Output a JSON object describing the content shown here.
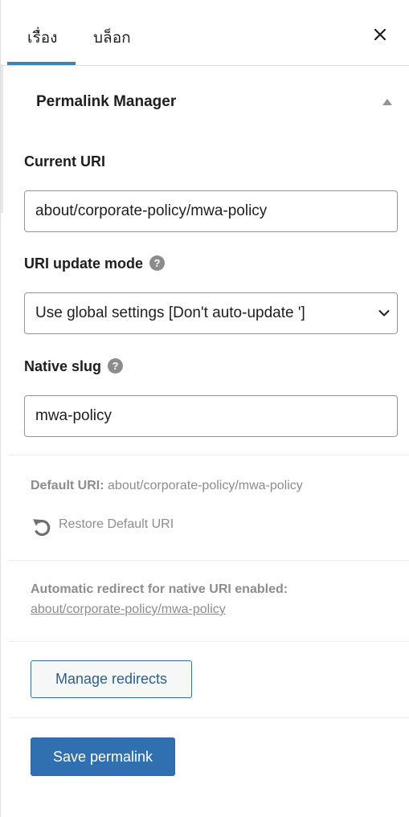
{
  "tabs": {
    "story_label": "เรื่อง",
    "block_label": "บล็อก",
    "close_symbol": "×"
  },
  "section": {
    "title": "Permalink Manager"
  },
  "current_uri": {
    "label": "Current URI",
    "value": "about/corporate-policy/mwa-policy"
  },
  "uri_update_mode": {
    "label": "URI update mode",
    "help_symbol": "?",
    "selected": "Use global settings [Don't auto-update ']"
  },
  "native_slug": {
    "label": "Native slug",
    "help_symbol": "?",
    "value": "mwa-policy"
  },
  "default_uri": {
    "label": "Default URI:",
    "value": "about/corporate-policy/mwa-policy"
  },
  "restore": {
    "label": "Restore Default URI"
  },
  "auto_redirect": {
    "label": "Automatic redirect for native URI enabled:",
    "link": "about/corporate-policy/mwa-policy"
  },
  "buttons": {
    "manage_redirects": "Manage redirects",
    "save_permalink": "Save permalink"
  },
  "colors": {
    "accent": "#3070b0",
    "tab_underline": "#3b82b8",
    "muted_text": "#8d8d8d"
  }
}
